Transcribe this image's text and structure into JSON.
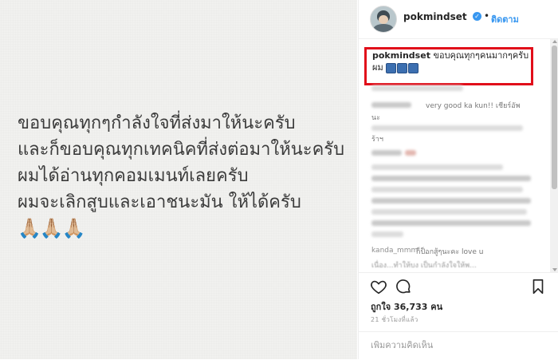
{
  "post": {
    "lines": [
      "ขอบคุณทุกๆกำลังใจที่ส่งมาให้นะครับ",
      "และก็ขอบคุณทุกเทคนิคที่ส่งต่อมาให้นะครับ",
      "ผมได้อ่านทุกคอมเมนท์เลยครับ",
      "ผมจะเลิกสูบและเอาชนะมัน ให้ได้ครับ"
    ],
    "emoji": "🙏🏼🙏🏼🙏🏼"
  },
  "header": {
    "username": "pokmindset",
    "verified_mark": "✓",
    "separator": "•",
    "follow_label": "ติดตาม"
  },
  "caption": {
    "username": "pokmindset",
    "text": "ขอบคุณทุกๆคนมากๆครับผม"
  },
  "comments": {
    "visible_fragments": {
      "c1_text": "very good ka kun!! เชียร์อัพ",
      "c1_cont": "นะ",
      "c2_text": "ร้าฯ",
      "c3_user": "kanda_mmm",
      "c3_text": "ก็ป็อกสู้ๆนะคะ love u",
      "c4_text": "เนื่อง...ทำให้บง เป็นกำลังใจให้พ..."
    }
  },
  "stats": {
    "likes": "ถูกใจ 36,733 คน",
    "time": "21 ชั่วโมงที่แล้ว"
  },
  "add_comment": {
    "placeholder": "เพิ่มความคิดเห็น"
  },
  "colors": {
    "highlight": "#e10e1a",
    "link_blue": "#3897f0",
    "text_dark": "#262626"
  },
  "icons": [
    "heart-icon",
    "comment-icon",
    "bookmark-icon",
    "verified-badge-icon"
  ]
}
